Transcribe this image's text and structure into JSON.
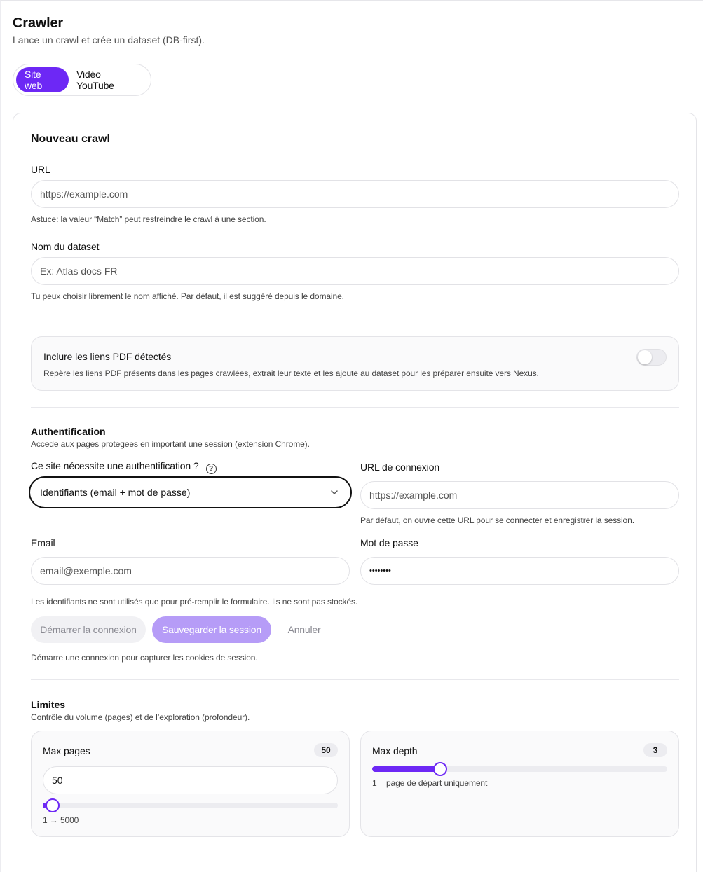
{
  "header": {
    "title": "Crawler",
    "subtitle": "Lance un crawl et crée un dataset (DB-first)."
  },
  "tabs": [
    {
      "label": "Site web",
      "active": true
    },
    {
      "label": "Vidéo YouTube",
      "active": false
    }
  ],
  "form": {
    "title": "Nouveau crawl",
    "url": {
      "label": "URL",
      "placeholder": "https://example.com",
      "help": "Astuce: la valeur “Match” peut restreindre le crawl à une section."
    },
    "dataset": {
      "label": "Nom du dataset",
      "placeholder": "Ex: Atlas docs FR",
      "help": "Tu peux choisir librement le nom affiché. Par défaut, il est suggéré depuis le domaine."
    },
    "pdf": {
      "title": "Inclure les liens PDF détectés",
      "description": "Repère les liens PDF présents dans les pages crawlées, extrait leur texte et les ajoute au dataset pour les préparer ensuite vers Nexus.",
      "enabled": false
    },
    "auth": {
      "title": "Authentification",
      "subtitle": "Accede aux pages protegees en important une session (extension Chrome).",
      "requires_label": "Ce site nécessite une authentification ?",
      "method_value": "Identifiants (email + mot de passe)",
      "login_url_label": "URL de connexion",
      "login_url_placeholder": "https://example.com",
      "login_url_help": "Par défaut, on ouvre cette URL pour se connecter et enregistrer la session.",
      "email_label": "Email",
      "email_placeholder": "email@exemple.com",
      "password_label": "Mot de passe",
      "password_placeholder": "••••••••",
      "credentials_help": "Les identifiants ne sont utilisés que pour pré-remplir le formulaire. Ils ne sont pas stockés.",
      "start_button": "Démarrer la connexion",
      "save_button": "Sauvegarder la session",
      "cancel_button": "Annuler",
      "session_help": "Démarre une connexion pour capturer les cookies de session."
    },
    "limits": {
      "title": "Limites",
      "subtitle": "Contrôle du volume (pages) et de l’exploration (profondeur).",
      "max_pages": {
        "label": "Max pages",
        "badge": "50",
        "value": "50",
        "range_text": "1 → 5000",
        "min": 1,
        "max": 5000,
        "current": 50
      },
      "max_depth": {
        "label": "Max depth",
        "badge": "3",
        "help": "1 = page de départ uniquement",
        "fraction": 0.23
      }
    }
  },
  "colors": {
    "accent": "#6d28f5",
    "accent_light": "#b69cf7",
    "border": "#e4e4e8"
  }
}
